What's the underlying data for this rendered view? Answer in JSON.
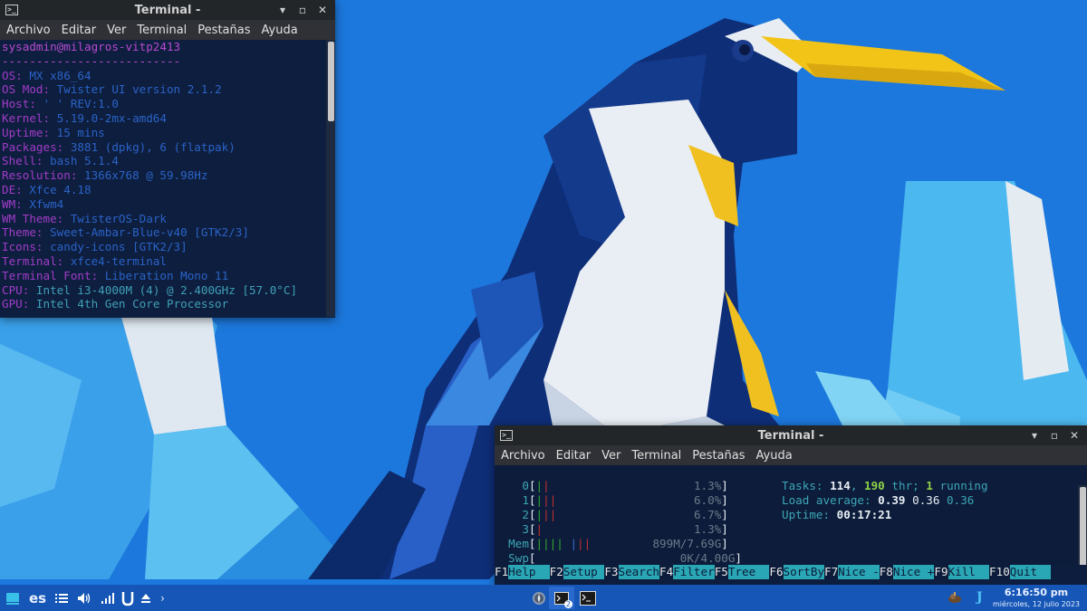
{
  "colors": {
    "taskbar": "#1656b6",
    "terminal_bg": "#0d1d3d",
    "accent_cyan": "#2aa7b5"
  },
  "win1": {
    "title": "Terminal -",
    "menu": [
      "Archivo",
      "Editar",
      "Ver",
      "Terminal",
      "Pestañas",
      "Ayuda"
    ],
    "header": "sysadmin@milagros-vitp2413",
    "separator": "--------------------------",
    "info": [
      {
        "key": "OS:",
        "value": " MX x86_64"
      },
      {
        "key": "OS Mod:",
        "value": " Twister UI version 2.1.2"
      },
      {
        "key": "Host:",
        "value": " ' ' REV:1.0"
      },
      {
        "key": "Kernel:",
        "value": " 5.19.0-2mx-amd64"
      },
      {
        "key": "Uptime:",
        "value": " 15 mins"
      },
      {
        "key": "Packages:",
        "value": " 3881 (dpkg), 6 (flatpak)"
      },
      {
        "key": "Shell:",
        "value": " bash 5.1.4"
      },
      {
        "key": "Resolution:",
        "value": " 1366x768 @ 59.98Hz"
      },
      {
        "key": "DE:",
        "value": " Xfce 4.18"
      },
      {
        "key": "WM:",
        "value": " Xfwm4"
      },
      {
        "key": "WM Theme:",
        "value": " TwisterOS-Dark"
      },
      {
        "key": "Theme:",
        "value": " Sweet-Ambar-Blue-v40 [GTK2/3]"
      },
      {
        "key": "Icons:",
        "value": " candy-icons [GTK2/3]"
      },
      {
        "key": "Terminal:",
        "value": " xfce4-terminal"
      },
      {
        "key": "Terminal Font:",
        "value": " Liberation Mono 11"
      },
      {
        "key": "CPU:",
        "value": " Intel i3-4000M (4) @ 2.400GHz [57.0°C]"
      },
      {
        "key": "GPU:",
        "value": " Intel 4th Gen Core Processor"
      }
    ]
  },
  "win2": {
    "title": "Terminal -",
    "menu": [
      "Archivo",
      "Editar",
      "Ver",
      "Terminal",
      "Pestañas",
      "Ayuda"
    ],
    "cpus": [
      {
        "id": "0",
        "percent": "1.3%"
      },
      {
        "id": "1",
        "percent": "6.0%"
      },
      {
        "id": "2",
        "percent": "6.7%"
      },
      {
        "id": "3",
        "percent": "1.3%"
      }
    ],
    "mem": {
      "label": "Mem",
      "value": "899M/7.69G"
    },
    "swp": {
      "label": "Swp",
      "value": "0K/4.00G"
    },
    "tasks": {
      "label": "Tasks:",
      "count": "114",
      "thr": "190",
      "thr_label": "thr;",
      "running": "1",
      "running_label": "running"
    },
    "load": {
      "label": "Load average:",
      "v1": "0.39",
      "v2": "0.36",
      "v3": "0.36"
    },
    "uptime": {
      "label": "Uptime:",
      "value": "00:17:21"
    },
    "fkeys": [
      {
        "n": "F1",
        "l": "Help  "
      },
      {
        "n": "F2",
        "l": "Setup "
      },
      {
        "n": "F3",
        "l": "Search"
      },
      {
        "n": "F4",
        "l": "Filter"
      },
      {
        "n": "F5",
        "l": "Tree  "
      },
      {
        "n": "F6",
        "l": "SortBy"
      },
      {
        "n": "F7",
        "l": "Nice -"
      },
      {
        "n": "F8",
        "l": "Nice +"
      },
      {
        "n": "F9",
        "l": "Kill  "
      },
      {
        "n": "F10",
        "l": "Quit  "
      }
    ]
  },
  "taskbar": {
    "keyboard_layout": "es",
    "task_badge": "2",
    "clock_time": "6:16:50 pm",
    "clock_date": "miércoles, 12 julio 2023"
  }
}
